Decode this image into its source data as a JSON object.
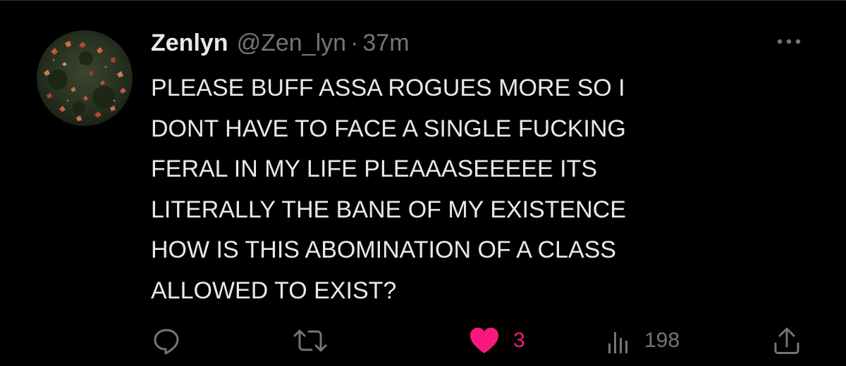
{
  "tweet": {
    "author": {
      "display_name": "Zenlyn",
      "handle": "@Zen_lyn",
      "separator": "·",
      "time": "37m"
    },
    "text_lines": [
      "PLEASE BUFF ASSA ROGUES MORE SO I",
      "DONT HAVE TO FACE A SINGLE FUCKING",
      "FERAL IN MY LIFE PLEAAASEEEEE ITS",
      "LITERALLY THE BANE OF MY EXISTENCE",
      "HOW IS THIS ABOMINATION OF A CLASS",
      "ALLOWED TO EXIST?"
    ],
    "actions": {
      "reply": {
        "icon": "reply-icon"
      },
      "retweet": {
        "icon": "retweet-icon"
      },
      "like": {
        "icon": "heart-icon",
        "count": "3",
        "liked": true
      },
      "views": {
        "icon": "views-icon",
        "count": "198"
      },
      "share": {
        "icon": "share-icon"
      }
    },
    "more": {
      "icon": "more-icon"
    }
  },
  "colors": {
    "background": "#000000",
    "text_primary": "#e7e9ea",
    "text_secondary": "#71767b",
    "like_active": "#f91880"
  }
}
